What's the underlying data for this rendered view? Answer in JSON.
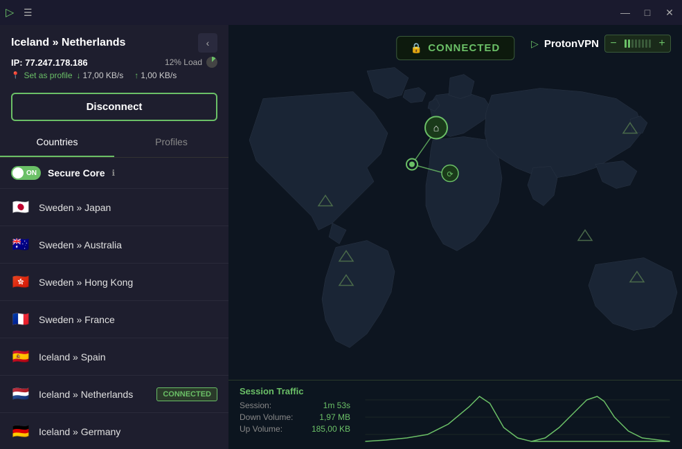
{
  "titlebar": {
    "logo": "▷",
    "menu_icon": "☰",
    "minimize": "—",
    "maximize": "□",
    "close": "✕"
  },
  "connection": {
    "server": "Iceland » Netherlands",
    "ip_label": "IP:",
    "ip_address": "77.247.178.186",
    "load_label": "12% Load",
    "set_profile_label": "Set as profile",
    "download_speed": "17,00 KB/s",
    "upload_speed": "1,00 KB/s",
    "disconnect_button": "Disconnect"
  },
  "tabs": {
    "countries": "Countries",
    "profiles": "Profiles"
  },
  "secure_core": {
    "toggle_label": "ON",
    "label": "Secure Core",
    "info": "ℹ"
  },
  "servers": [
    {
      "flag": "🇯🇵",
      "name": "Sweden » Japan",
      "connected": false
    },
    {
      "flag": "🇦🇺",
      "name": "Sweden » Australia",
      "connected": false
    },
    {
      "flag": "🇭🇰",
      "name": "Sweden » Hong Kong",
      "connected": false
    },
    {
      "flag": "🇫🇷",
      "name": "Sweden » France",
      "connected": false
    },
    {
      "flag": "🇪🇸",
      "name": "Iceland » Spain",
      "connected": false
    },
    {
      "flag": "🇳🇱",
      "name": "Iceland » Netherlands",
      "connected": true,
      "badge": "CONNECTED"
    },
    {
      "flag": "🇩🇪",
      "name": "Iceland » Germany",
      "connected": false
    }
  ],
  "status": {
    "icon": "🔒",
    "text": "CONNECTED"
  },
  "proton": {
    "icon": "▷",
    "name": "ProtonVPN"
  },
  "zoom": {
    "minus": "−",
    "plus": "+"
  },
  "traffic": {
    "title": "Session Traffic",
    "session_label": "Session:",
    "session_value": "1m 53s",
    "down_label": "Down Volume:",
    "down_value": "1,97   MB",
    "up_label": "Up Volume:",
    "up_value": "185,00  KB"
  }
}
